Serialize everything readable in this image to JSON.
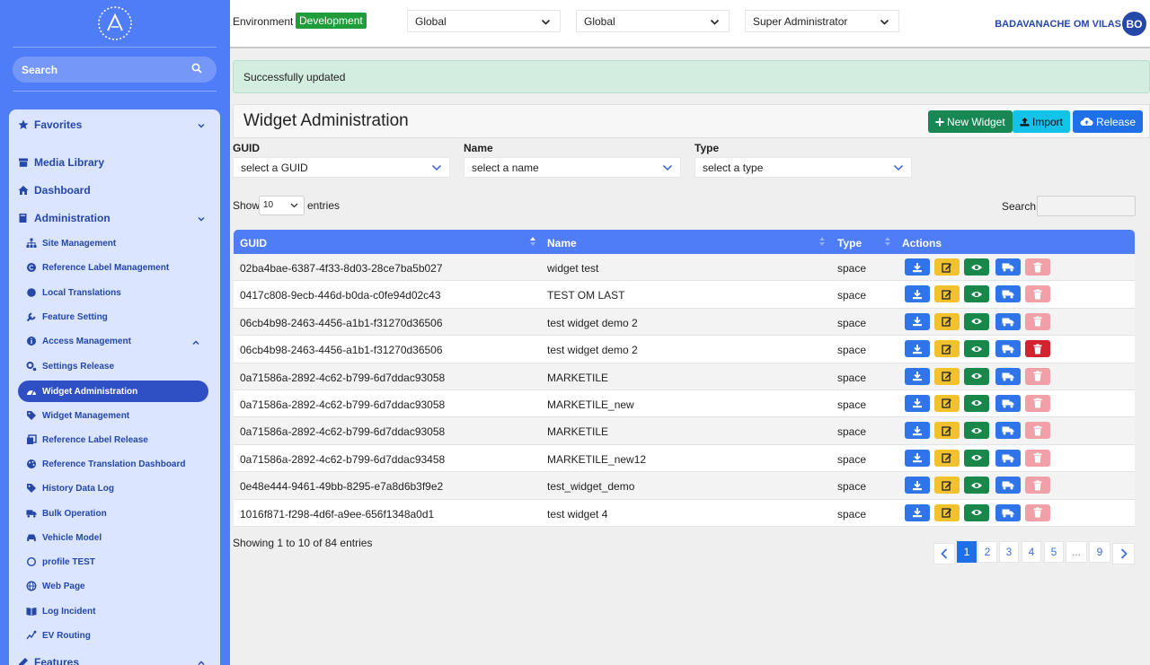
{
  "sidebar": {
    "search_placeholder": "Search",
    "items": [
      {
        "label": "Favorites"
      },
      {
        "label": "Media Library"
      },
      {
        "label": "Dashboard"
      },
      {
        "label": "Administration"
      },
      {
        "label": "Site Management"
      },
      {
        "label": "Reference Label Management"
      },
      {
        "label": "Local Translations"
      },
      {
        "label": "Feature Setting"
      },
      {
        "label": "Access Management"
      },
      {
        "label": "Settings Release"
      },
      {
        "label": "Widget Administration"
      },
      {
        "label": "Widget Management"
      },
      {
        "label": "Reference Label Release"
      },
      {
        "label": "Reference Translation Dashboard"
      },
      {
        "label": "History Data Log"
      },
      {
        "label": "Bulk Operation"
      },
      {
        "label": "Vehicle Model"
      },
      {
        "label": "profile TEST"
      },
      {
        "label": "Web Page"
      },
      {
        "label": "Log Incident"
      },
      {
        "label": "EV Routing"
      },
      {
        "label": "Features"
      }
    ]
  },
  "topbar": {
    "env_label": "Environment :",
    "env_value": "Development",
    "select1": "Global",
    "select2": "Global",
    "select3": "Super Administrator",
    "user_name": "BADAVANACHE OM VILAS",
    "user_initials": "BO"
  },
  "alert": "Successfully updated",
  "page": {
    "title": "Widget Administration",
    "new_widget": "New Widget",
    "import": "Import",
    "release": "Release"
  },
  "filters": {
    "guid_label": "GUID",
    "guid_placeholder": "select a GUID",
    "name_label": "Name",
    "name_placeholder": "select a name",
    "type_label": "Type",
    "type_placeholder": "select a type"
  },
  "table_controls": {
    "show": "Show",
    "page_size": "10",
    "entries": "entries",
    "search": "Search"
  },
  "table": {
    "columns": [
      "GUID",
      "Name",
      "Type",
      "Actions"
    ],
    "rows": [
      {
        "guid": "02ba4bae-6387-4f33-8d03-28ce7ba5b027",
        "name": "widget test",
        "type": "space"
      },
      {
        "guid": "0417c808-9ecb-446d-b0da-c0fe94d02c43",
        "name": "TEST OM LAST",
        "type": "space"
      },
      {
        "guid": "06cb4b98-2463-4456-a1b1-f31270d36506",
        "name": "test widget demo 2",
        "type": "space"
      },
      {
        "guid": "06cb4b98-2463-4456-a1b1-f31270d36506",
        "name": "test widget demo 2",
        "type": "space"
      },
      {
        "guid": "0a71586a-2892-4c62-b799-6d7ddac93058",
        "name": "MARKETILE",
        "type": "space"
      },
      {
        "guid": "0a71586a-2892-4c62-b799-6d7ddac93058",
        "name": "MARKETILE_new",
        "type": "space"
      },
      {
        "guid": "0a71586a-2892-4c62-b799-6d7ddac93058",
        "name": "MARKETILE",
        "type": "space"
      },
      {
        "guid": "0a71586a-2892-4c62-b799-6d7ddac93458",
        "name": "MARKETILE_new12",
        "type": "space"
      },
      {
        "guid": "0e48e444-9461-49bb-8295-e7a8d6b3f9e2",
        "name": "test_widget_demo",
        "type": "space"
      },
      {
        "guid": "1016f871-f298-4d6f-a9ee-656f1348a0d1",
        "name": "test widget 4",
        "type": "space"
      }
    ]
  },
  "footer": {
    "showing": "Showing 1 to 10 of 84 entries",
    "pages": [
      "1",
      "2",
      "3",
      "4",
      "5",
      "...",
      "9"
    ]
  }
}
